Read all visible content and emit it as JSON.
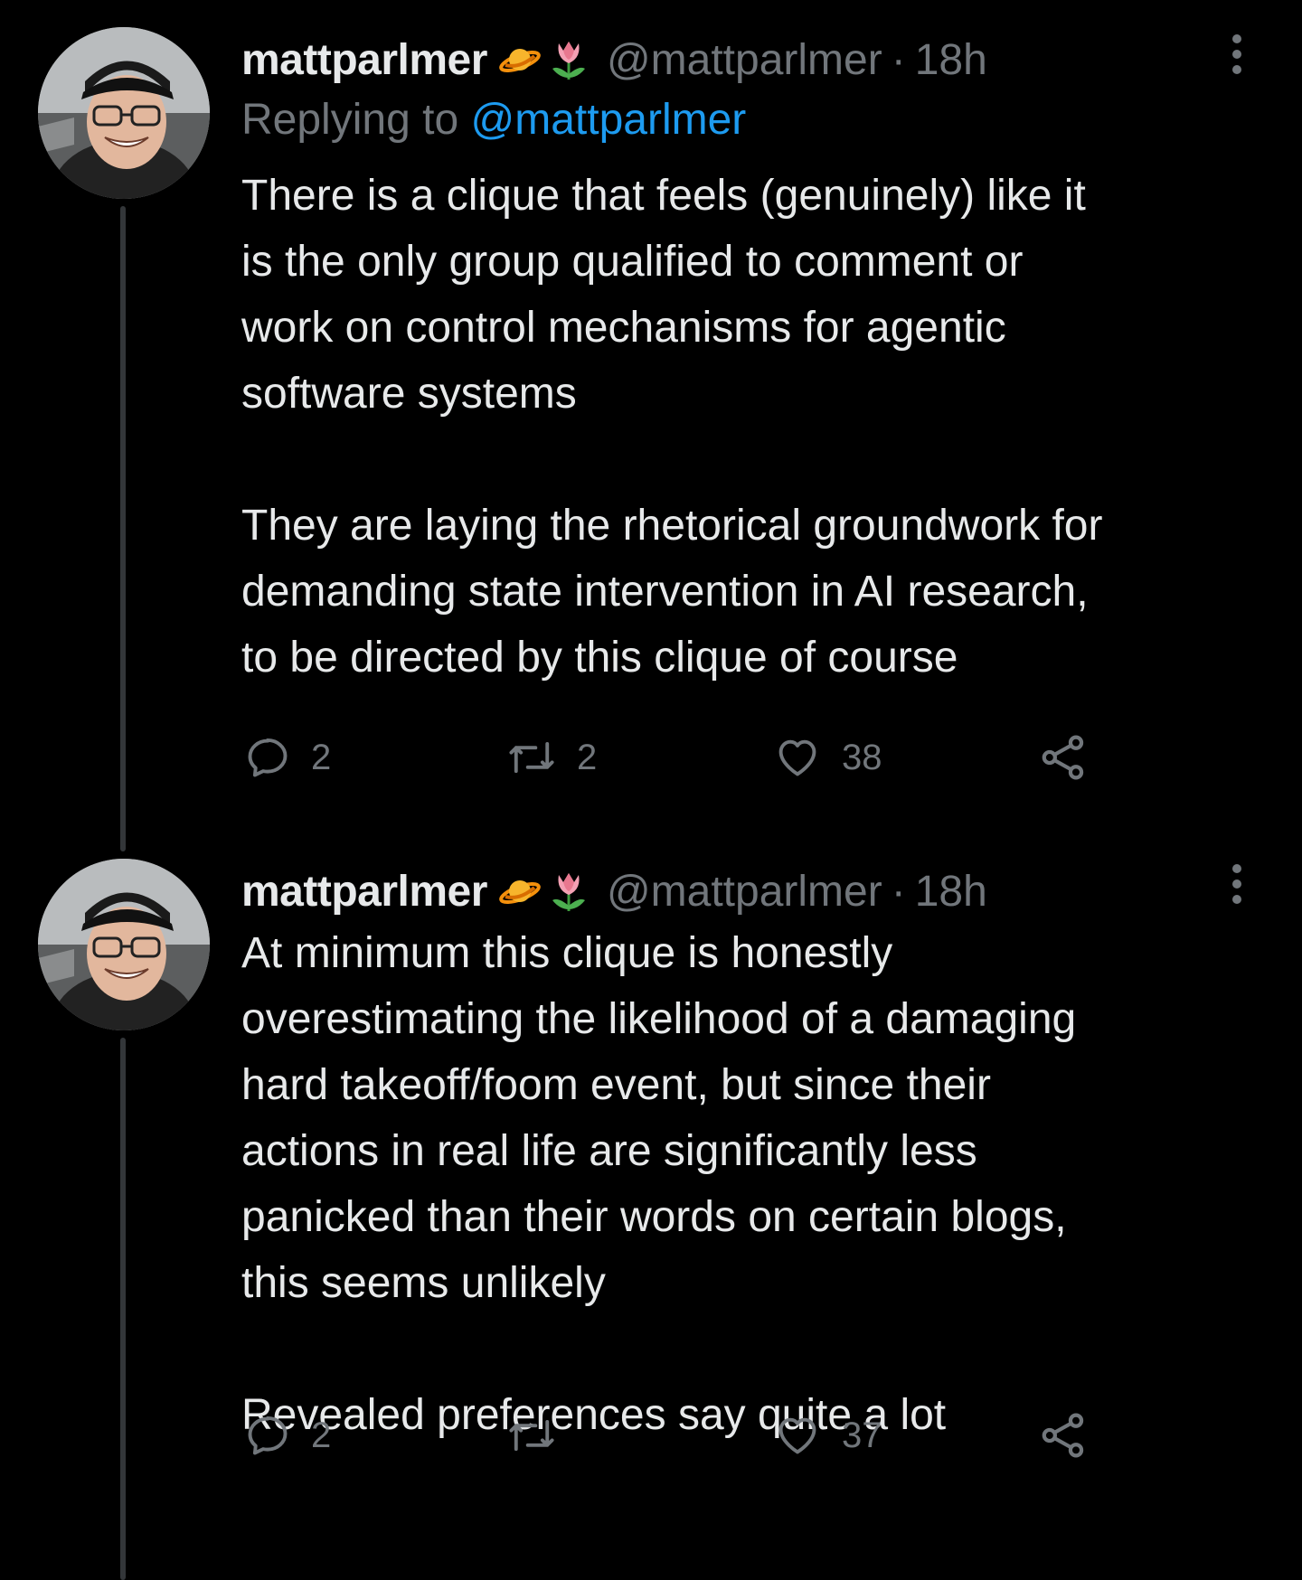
{
  "tweets": [
    {
      "display_name": "mattparlmer",
      "emoji": [
        "ringed-planet",
        "tulip"
      ],
      "handle": "@mattparlmer",
      "separator": "·",
      "time": "18h",
      "replying_prefix": "Replying to",
      "replying_handle": "@mattparlmer",
      "lines": [
        "There is a clique that feels (genuinely) like it",
        "is the only group qualified to comment or",
        "work on control mechanisms for agentic",
        "software systems",
        "",
        "They are laying the rhetorical groundwork for",
        "demanding state intervention in AI research,",
        "to be directed by this clique of course"
      ],
      "reply_count": "2",
      "retweet_count": "2",
      "like_count": "38"
    },
    {
      "display_name": "mattparlmer",
      "emoji": [
        "ringed-planet",
        "tulip"
      ],
      "handle": "@mattparlmer",
      "separator": "·",
      "time": "18h",
      "lines": [
        "At minimum this clique is honestly",
        "overestimating the likelihood of a damaging",
        "hard takeoff/foom event, but since their",
        "actions in real life are significantly less",
        "panicked than their words on certain blogs,",
        "this seems unlikely",
        "",
        "Revealed preferences say quite a lot"
      ],
      "reply_count": "2",
      "retweet_count": "",
      "like_count": "37"
    }
  ],
  "colors": {
    "background": "#000000",
    "text": "#e7e9ea",
    "secondary": "#71767b",
    "link": "#1d9bf0",
    "thread_line": "#333639"
  },
  "icons": [
    "more-icon",
    "reply-icon",
    "retweet-icon",
    "like-icon",
    "share-icon"
  ]
}
